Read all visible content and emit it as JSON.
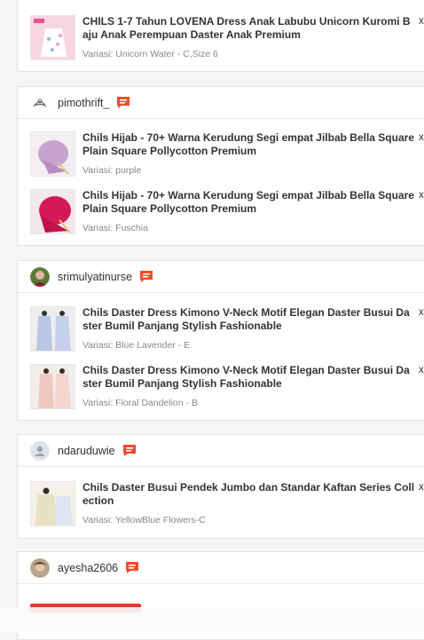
{
  "colors": {
    "accent": "#ee4d2d",
    "variant_text": "#888888",
    "chat_icon": "#ee4d2d"
  },
  "icons": {
    "chat": "chat-bubble-icon",
    "user": "user-placeholder-icon"
  },
  "orders": [
    {
      "shop": null,
      "items": [
        {
          "title": "CHILS 1-7 Tahun LOVENA Dress Anak Labubu Unicorn Kuromi Baju Anak Perempuan Daster Anak Premium",
          "variant": "Variasi: Unicorn Water - C,Size 6",
          "qty": "x"
        }
      ]
    },
    {
      "shop": "pimothrift_",
      "items": [
        {
          "title": "Chils Hijab - 70+ Warna Kerudung Segi empat Jilbab Bella Square Plain Square Pollycotton Premium",
          "variant": "Variasi: purple",
          "qty": "x"
        },
        {
          "title": "Chils Hijab - 70+ Warna Kerudung Segi empat Jilbab Bella Square Plain Square Pollycotton Premium",
          "variant": "Variasi: Fuschia",
          "qty": "x"
        }
      ]
    },
    {
      "shop": "srimulyatinurse",
      "items": [
        {
          "title": "Chils Daster Dress Kimono V-Neck Motif Elegan Daster Busui Daster Bumil Panjang Stylish Fashionable",
          "variant": "Variasi: Blue Lavender - E",
          "qty": "x"
        },
        {
          "title": "Chils Daster Dress Kimono V-Neck Motif Elegan Daster Busui Daster Bumil Panjang Stylish Fashionable",
          "variant": "Variasi: Floral Dandelion - B",
          "qty": "x"
        }
      ]
    },
    {
      "shop": "ndaruduwie",
      "items": [
        {
          "title": "Chils Daster Busui Pendek Jumbo dan Standar Kaftan Series Collection",
          "variant": "Variasi: YellowBlue Flowers-C",
          "qty": "x"
        }
      ]
    },
    {
      "shop": "ayesha2606",
      "items": []
    }
  ]
}
